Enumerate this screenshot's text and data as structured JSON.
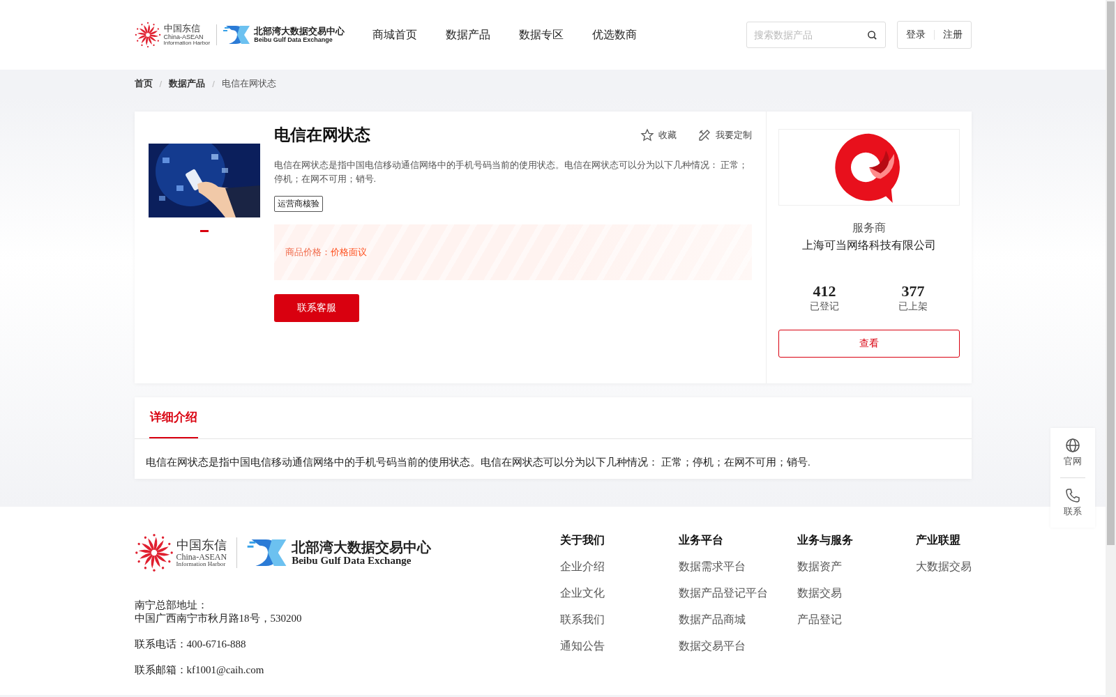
{
  "header": {
    "logo": {
      "cn": "中国东信",
      "en_1": "China-ASEAN",
      "en_2": "Information Harbor",
      "bx_cn": "北部湾大数据交易中心",
      "bx_en": "Beibu Gulf Data Exchange"
    },
    "nav": [
      "商城首页",
      "数据产品",
      "数据专区",
      "优选数商"
    ],
    "search": {
      "placeholder": "搜索数据产品"
    },
    "auth": [
      "登录",
      "注册"
    ]
  },
  "breadcrumb": [
    {
      "label": "首页",
      "kind": "link"
    },
    {
      "label": "/",
      "kind": "separator"
    },
    {
      "label": "数据产品",
      "kind": "link"
    },
    {
      "label": "/",
      "kind": "separator"
    },
    {
      "label": "电信在网状态",
      "kind": "current"
    }
  ],
  "product": {
    "image": {
      "kind": "picture"
    },
    "carousel_dots": [
      {
        "selected": true
      }
    ],
    "title": "电信在网状态",
    "actions": [
      {
        "label": "收藏",
        "kind": "favorite"
      },
      {
        "label": "我要定制",
        "kind": "customize"
      }
    ],
    "description": "电信在网状态是指中国电信移动通信网络中的手机号码当前的使用状态。电信在网状态可以分为以下几种情况： 正常；停机；在网不可用；销号.",
    "tags": [
      "运营商核验"
    ],
    "price": {
      "label": "商品价格：",
      "value": "价格面议"
    },
    "contact_button": "联系客服"
  },
  "provider": {
    "role": "服务商",
    "name": "上海可当网络科技有限公司",
    "stats": [
      {
        "value": "412",
        "label": "已登记"
      },
      {
        "value": "377",
        "label": "已上架"
      }
    ],
    "view_button": "查看"
  },
  "details": {
    "tabs": [
      {
        "label": "详细介绍",
        "selected": true
      }
    ],
    "text": "电信在网状态是指中国电信移动通信网络中的手机号码当前的使用状态。电信在网状态可以分为以下几种情况： 正常；停机；在网不可用；销号."
  },
  "footer": {
    "logo": {
      "cn": "中国东信",
      "en_1": "China-ASEAN",
      "en_2": "Information Harbor",
      "bx_cn": "北部湾大数据交易中心",
      "bx_en": "Beibu Gulf Data Exchange"
    },
    "address_label": "南宁总部地址：",
    "address": "中国广西南宁市秋月路18号，530200",
    "phone": "联系电话：400-6716-888",
    "email": "联系邮箱：kf1001@caih.com",
    "columns": [
      {
        "title": "关于我们",
        "links": [
          "企业介绍",
          "企业文化",
          "联系我们",
          "通知公告"
        ]
      },
      {
        "title": "业务平台",
        "links": [
          "数据需求平台",
          "数据产品登记平台",
          "数据产品商城",
          "数据交易平台"
        ]
      },
      {
        "title": "业务与服务",
        "links": [
          "数据资产",
          "数据交易",
          "产品登记"
        ]
      },
      {
        "title": "产业联盟",
        "links": [
          "大数据交易"
        ]
      }
    ]
  },
  "float_bar": [
    {
      "label": "官网",
      "kind": "website"
    },
    {
      "label": "联系",
      "kind": "contact"
    }
  ]
}
